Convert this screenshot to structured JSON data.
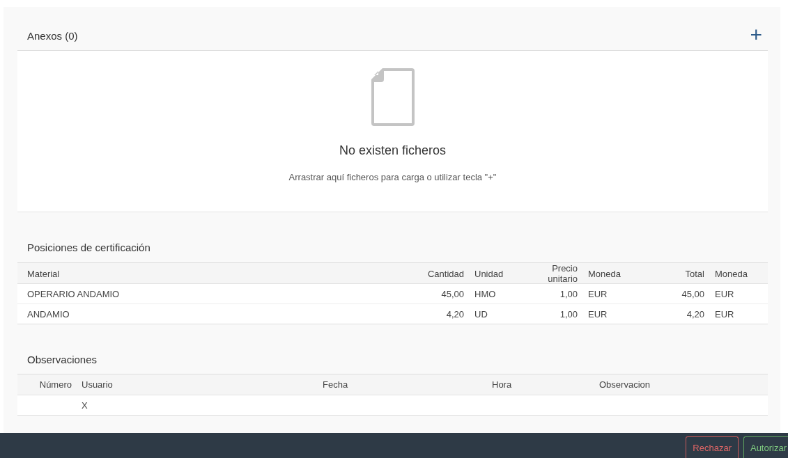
{
  "annexes": {
    "title": "Anexos (0)",
    "add_label": "+",
    "empty_title": "No existen ficheros",
    "empty_hint": "Arrastrar aquí ficheros para carga o utilizar tecla \"+\""
  },
  "positions": {
    "title": "Posiciones de certificación",
    "columns": [
      {
        "label": "Material",
        "kind": "text"
      },
      {
        "label": "Cantidad",
        "kind": "number"
      },
      {
        "label": "Unidad",
        "kind": "text"
      },
      {
        "label": "Precio unitario",
        "kind": "number"
      },
      {
        "label": "Moneda",
        "kind": "text"
      },
      {
        "label": "Total",
        "kind": "number"
      },
      {
        "label": "Moneda",
        "kind": "text"
      }
    ],
    "rows": [
      [
        "OPERARIO ANDAMIO",
        "45,00",
        "HMO",
        "1,00",
        "EUR",
        "45,00",
        "EUR"
      ],
      [
        "ANDAMIO",
        "4,20",
        "UD",
        "1,00",
        "EUR",
        "4,20",
        "EUR"
      ]
    ]
  },
  "observations": {
    "title": "Observaciones",
    "columns": [
      {
        "label": "Número",
        "kind": "number"
      },
      {
        "label": "Usuario",
        "kind": "text"
      },
      {
        "label": "Fecha",
        "kind": "text"
      },
      {
        "label": "Hora",
        "kind": "text"
      },
      {
        "label": "Observacion",
        "kind": "text"
      }
    ],
    "rows": [
      [
        "",
        "X",
        "",
        "",
        ""
      ]
    ]
  },
  "buttons": [
    {
      "label": "Rechazar",
      "kind": "danger"
    },
    {
      "label": "Autorizar",
      "kind": "success"
    }
  ]
}
